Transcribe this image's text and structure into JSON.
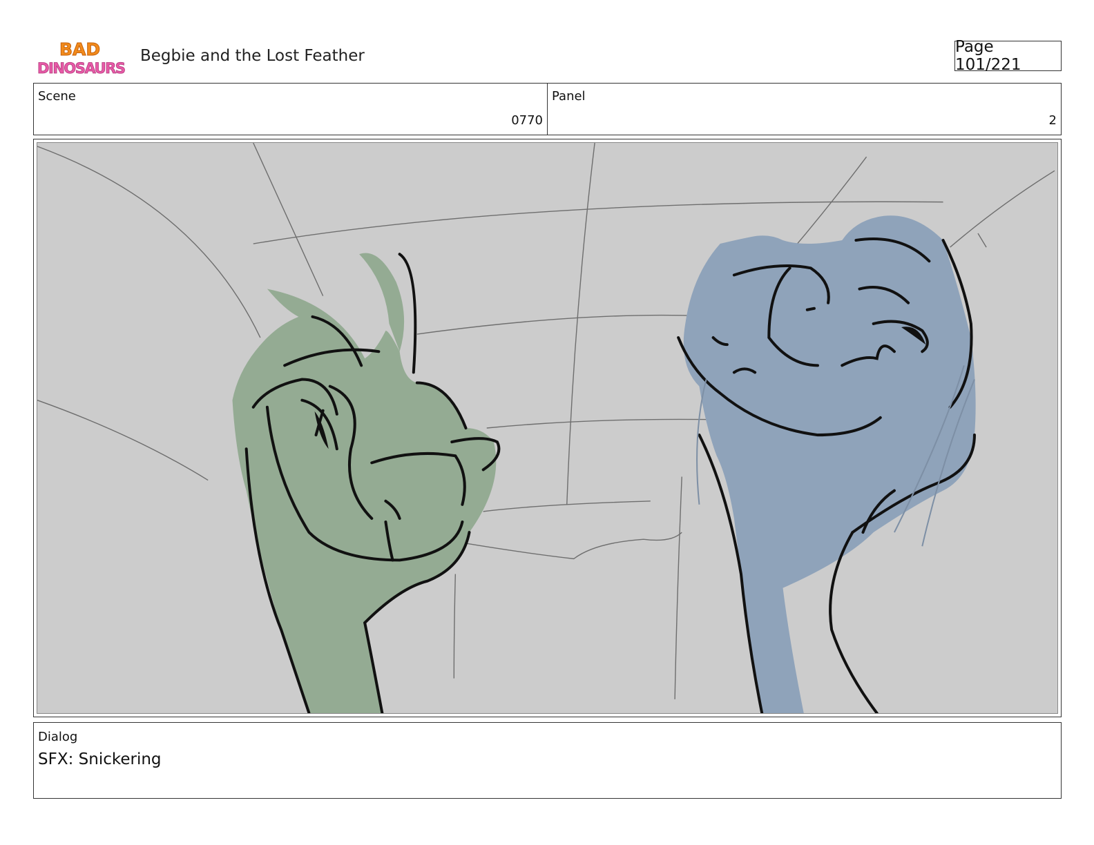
{
  "header": {
    "logo_text_line1": "BAD",
    "logo_text_line2": "DINOSAURS",
    "title": "Begbie and the Lost Feather",
    "page": "Page 101/221"
  },
  "info": {
    "scene_label": "Scene",
    "scene_value": "0770",
    "panel_label": "Panel",
    "panel_value": "2"
  },
  "dialog": {
    "label": "Dialog",
    "text": "SFX: Snickering"
  },
  "colors": {
    "frame_background": "#cccccc",
    "green_dino": "#94ab93",
    "blue_dino": "#8fa3ba",
    "ink": "#111111"
  }
}
